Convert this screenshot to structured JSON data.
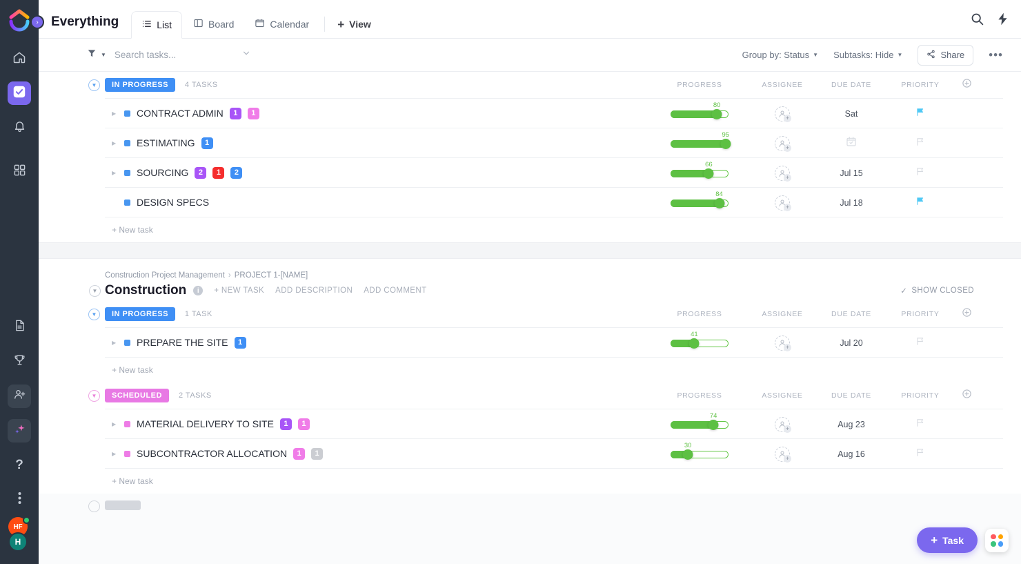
{
  "rail": {
    "logo_name": "clickup-logo",
    "expand_label": "›",
    "items": [
      {
        "name": "home",
        "icon": "home-icon"
      },
      {
        "name": "tasks",
        "icon": "checkbox-icon",
        "active": true
      },
      {
        "name": "notifications",
        "icon": "bell-icon"
      },
      {
        "name": "dashboards",
        "icon": "grid-icon"
      },
      {
        "name": "docs",
        "icon": "document-icon"
      },
      {
        "name": "goals",
        "icon": "trophy-icon"
      },
      {
        "name": "invite",
        "icon": "add-user-icon"
      },
      {
        "name": "ai",
        "icon": "sparkle-icon"
      },
      {
        "name": "help",
        "icon": "question-icon"
      },
      {
        "name": "more",
        "icon": "more-vertical-icon"
      }
    ],
    "avatar_primary": "HF",
    "avatar_secondary": "H"
  },
  "header": {
    "workspace_title": "Everything",
    "tabs": [
      {
        "label": "List",
        "icon": "list-icon",
        "active": true
      },
      {
        "label": "Board",
        "icon": "board-icon",
        "active": false
      },
      {
        "label": "Calendar",
        "icon": "calendar-icon",
        "active": false
      }
    ],
    "add_view_label": "View",
    "search_icon": "search-icon",
    "bolt_icon": "lightning-icon"
  },
  "toolbar": {
    "filter_icon": "filter-icon",
    "search_placeholder": "Search tasks...",
    "search_value": "",
    "group_by_label": "Group by: Status",
    "subtasks_label": "Subtasks: Hide",
    "share_label": "Share",
    "more_label": "•••"
  },
  "columns": {
    "progress": "PROGRESS",
    "assignee": "ASSIGNEE",
    "due_date": "DUE DATE",
    "priority": "PRIORITY",
    "add": "+"
  },
  "colors": {
    "in_progress": "#3f8ff5",
    "scheduled": "#e879e4",
    "progress_green": "#5dc043",
    "accent_purple": "#7b68ee",
    "flag_active": "#4ec8f5"
  },
  "new_task_label": "+ New task",
  "blocks": [
    {
      "name": "everything-block",
      "has_list_header": false,
      "groups": [
        {
          "status": "IN PROGRESS",
          "status_color": "#3f8ff5",
          "count_label": "4 TASKS",
          "tasks": [
            {
              "name": "CONTRACT ADMIN",
              "dot_color": "#4896f0",
              "has_caret": true,
              "badges": [
                {
                  "value": "1",
                  "color": "#a855f7"
                },
                {
                  "value": "1",
                  "color": "#f07ce8"
                }
              ],
              "progress": 80,
              "due_date": "Sat",
              "due_empty": false,
              "priority_flag": true
            },
            {
              "name": "ESTIMATING",
              "dot_color": "#4896f0",
              "has_caret": true,
              "badges": [
                {
                  "value": "1",
                  "color": "#3f8ff5"
                }
              ],
              "progress": 95,
              "due_date": "",
              "due_empty": true,
              "priority_flag": false
            },
            {
              "name": "SOURCING",
              "dot_color": "#4896f0",
              "has_caret": true,
              "badges": [
                {
                  "value": "2",
                  "color": "#a855f7"
                },
                {
                  "value": "1",
                  "color": "#f52d2d"
                },
                {
                  "value": "2",
                  "color": "#3f8ff5"
                }
              ],
              "progress": 66,
              "due_date": "Jul 15",
              "due_empty": false,
              "priority_flag": false
            },
            {
              "name": "DESIGN SPECS",
              "dot_color": "#4896f0",
              "has_caret": false,
              "badges": [],
              "progress": 84,
              "due_date": "Jul 18",
              "due_empty": false,
              "priority_flag": true
            }
          ]
        }
      ]
    },
    {
      "name": "construction-block",
      "has_list_header": true,
      "list_header": {
        "breadcrumb_root": "Construction Project Management",
        "breadcrumb_child": "PROJECT 1-[NAME]",
        "title": "Construction",
        "actions": [
          "+ NEW TASK",
          "ADD DESCRIPTION",
          "ADD COMMENT"
        ],
        "show_closed": "SHOW CLOSED"
      },
      "groups": [
        {
          "status": "IN PROGRESS",
          "status_color": "#3f8ff5",
          "count_label": "1 TASK",
          "tasks": [
            {
              "name": "PREPARE THE SITE",
              "dot_color": "#4896f0",
              "has_caret": true,
              "badges": [
                {
                  "value": "1",
                  "color": "#3f8ff5"
                }
              ],
              "progress": 41,
              "due_date": "Jul 20",
              "due_empty": false,
              "priority_flag": false
            }
          ]
        },
        {
          "status": "SCHEDULED",
          "status_color": "#e879e4",
          "count_label": "2 TASKS",
          "tasks": [
            {
              "name": "MATERIAL DELIVERY TO SITE",
              "dot_color": "#ee7ce6",
              "has_caret": true,
              "badges": [
                {
                  "value": "1",
                  "color": "#a855f7"
                },
                {
                  "value": "1",
                  "color": "#f07ce8"
                }
              ],
              "progress": 74,
              "due_date": "Aug 23",
              "due_empty": false,
              "priority_flag": false
            },
            {
              "name": "SUBCONTRACTOR ALLOCATION",
              "dot_color": "#ee7ce6",
              "has_caret": true,
              "badges": [
                {
                  "value": "1",
                  "color": "#f07ce8"
                },
                {
                  "value": "1",
                  "color": "#cbcdd2"
                }
              ],
              "progress": 30,
              "due_date": "Aug 16",
              "due_empty": false,
              "priority_flag": false
            }
          ]
        }
      ]
    }
  ],
  "fab": {
    "task_label": "Task",
    "apps_icon": "apps-grid-icon"
  }
}
